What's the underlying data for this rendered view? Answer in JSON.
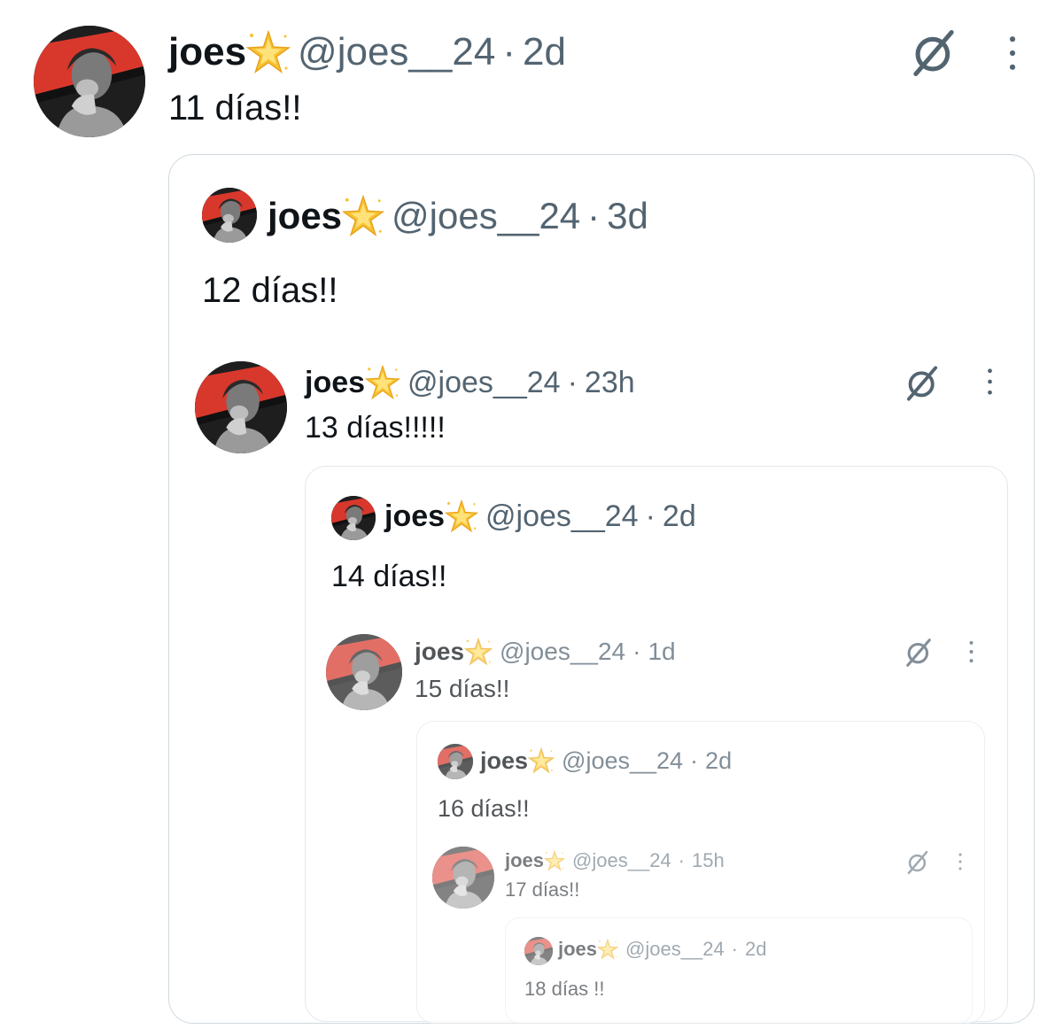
{
  "tweets": [
    {
      "name": "joes",
      "handle": "@joes__24",
      "sep": "·",
      "time": "2d",
      "text": "11 días!!"
    },
    {
      "name": "joes",
      "handle": "@joes__24",
      "sep": "·",
      "time": "3d",
      "text": "12 días!!"
    },
    {
      "name": "joes",
      "handle": "@joes__24",
      "sep": "·",
      "time": "23h",
      "text": "13 días!!!!!"
    },
    {
      "name": "joes",
      "handle": "@joes__24",
      "sep": "·",
      "time": "2d",
      "text": "14 días!!"
    },
    {
      "name": "joes",
      "handle": "@joes__24",
      "sep": "·",
      "time": "1d",
      "text": "15 días!!"
    },
    {
      "name": "joes",
      "handle": "@joes__24",
      "sep": "·",
      "time": "2d",
      "text": "16 días!!"
    },
    {
      "name": "joes",
      "handle": "@joes__24",
      "sep": "·",
      "time": "15h",
      "text": "17 días!!"
    },
    {
      "name": "joes",
      "handle": "@joes__24",
      "sep": "·",
      "time": "2d",
      "text": "18 días !!"
    }
  ],
  "icons": {
    "verified_emoji": "glowing-star-icon",
    "grok": "grok-icon",
    "more": "more-options-icon"
  },
  "colors": {
    "avatar_red": "#d8382c",
    "handle_gray": "#536471",
    "border": "#cfd9de",
    "star_yellow": "#f7c331"
  }
}
